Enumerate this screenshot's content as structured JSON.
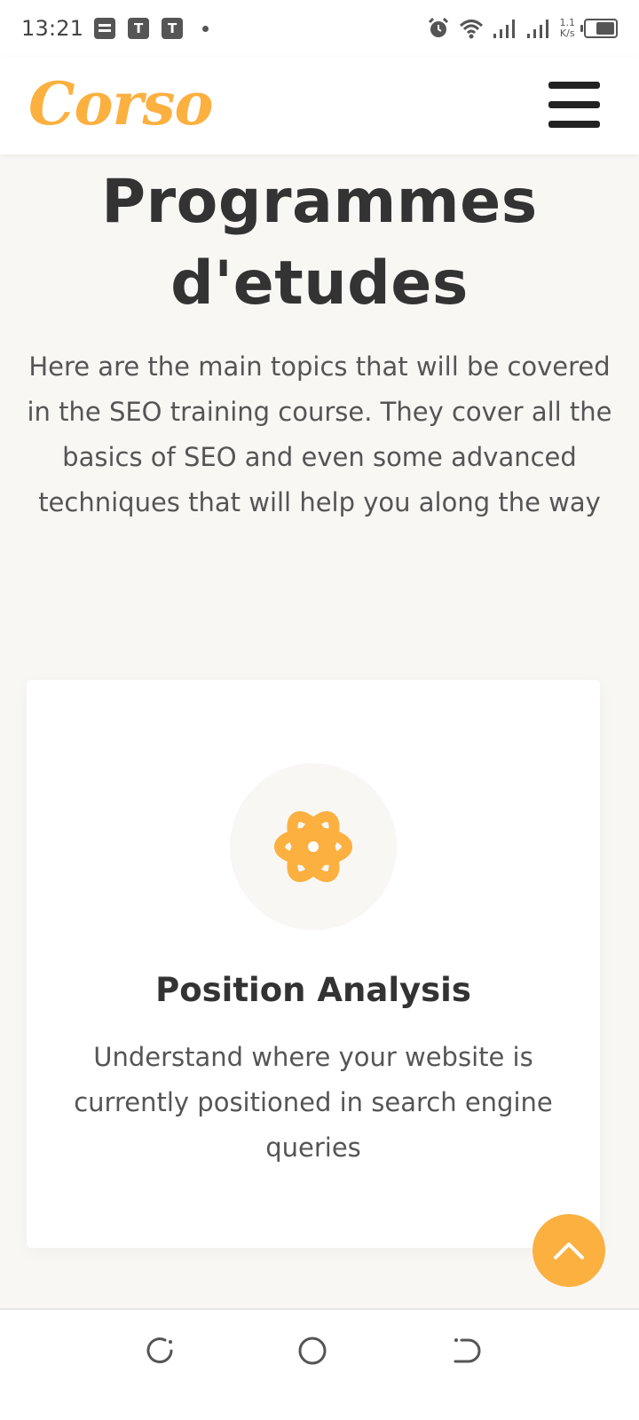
{
  "status_bar": {
    "time": "13:21",
    "notification_icons": [
      "notes-icon",
      "t-app-icon",
      "t-app-icon",
      "dot-icon"
    ],
    "t_label": "T",
    "net_speed_value": "1.1",
    "net_speed_unit": "K/s",
    "right_icons": [
      "alarm-icon",
      "wifi-icon",
      "signal-icon",
      "signal-icon",
      "battery-icon"
    ]
  },
  "header": {
    "logo": "Corso",
    "menu_icon": "hamburger-menu-icon"
  },
  "section": {
    "title_line1": "Programmes",
    "title_line2": "d'etudes",
    "intro": "Here are the main topics that will be covered in the SEO training course. They cover all the basics of SEO and even some advanced techniques that will help you along the way"
  },
  "card": {
    "icon": "atom-icon",
    "title": "Position Analysis",
    "description": "Understand where your website is currently positioned in search engine queries"
  },
  "back_to_top": {
    "icon": "chevron-up-icon"
  },
  "nav_bar": {
    "icons": [
      "recent-apps-icon",
      "home-icon",
      "back-icon"
    ]
  },
  "colors": {
    "accent": "#fbb040",
    "page_background": "#f8f7f4",
    "text_dark": "#333333",
    "text_body": "#555555"
  }
}
